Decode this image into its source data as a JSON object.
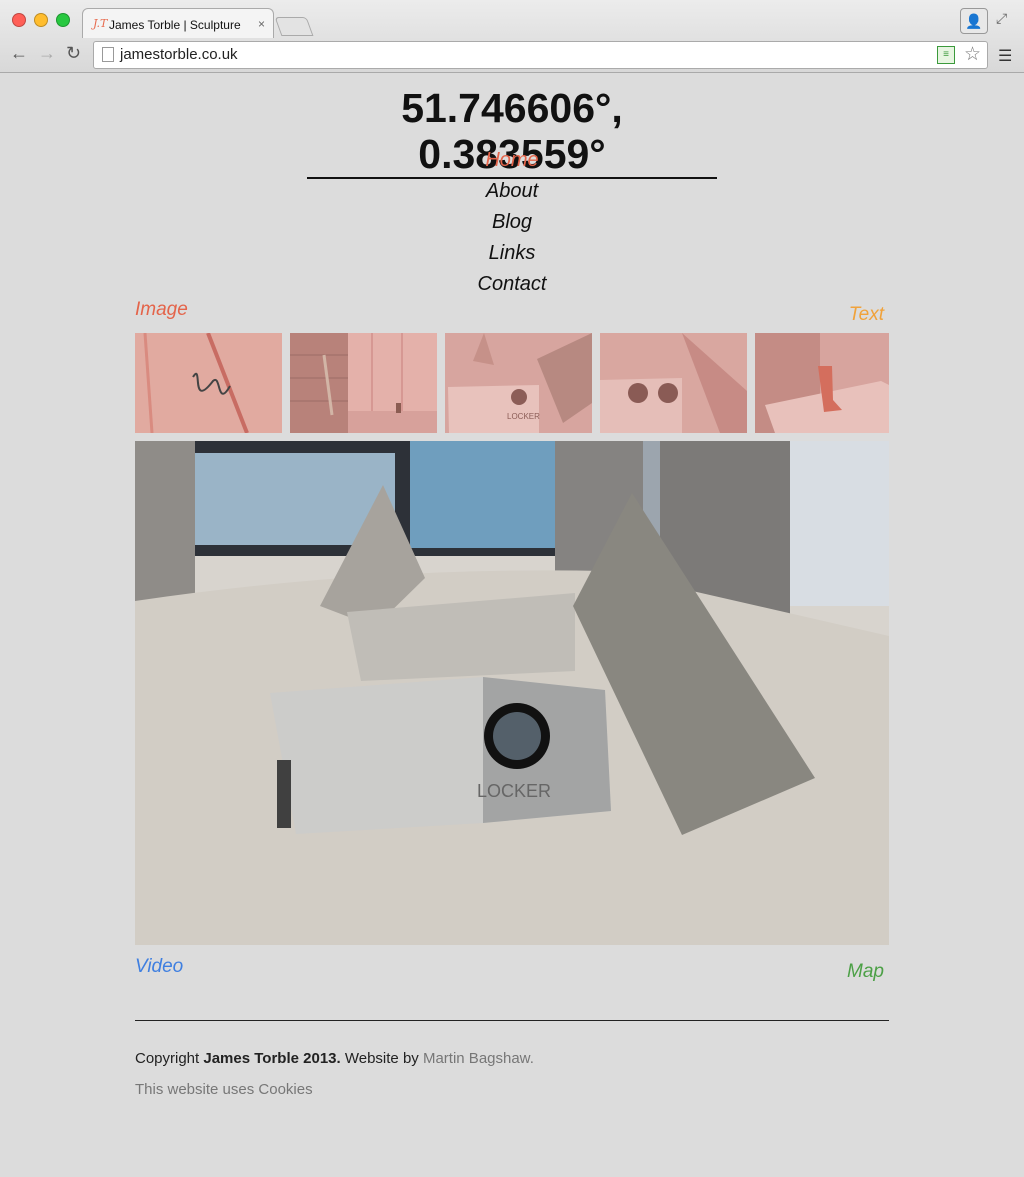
{
  "browser": {
    "tab": {
      "favicon": "J.T",
      "title": "James Torble | Sculpture",
      "close": "×"
    },
    "url": "jamestorble.co.uk",
    "colors": {
      "favicon": "#e76b4f"
    }
  },
  "site": {
    "title": "51.746606°, 0.383559°",
    "nav": [
      {
        "label": "Home",
        "active": true
      },
      {
        "label": "About",
        "active": false
      },
      {
        "label": "Blog",
        "active": false
      },
      {
        "label": "Links",
        "active": false
      },
      {
        "label": "Contact",
        "active": false
      }
    ],
    "corners": {
      "image": "Image",
      "text": "Text",
      "video": "Video",
      "map": "Map"
    },
    "colors": {
      "image": "#e4644a",
      "text": "#f0a23b",
      "video": "#3f7fe0",
      "map": "#4ca046"
    },
    "main_image_text": "LOCKER"
  },
  "footer": {
    "copyright_prefix": "Copyright",
    "owner": "James Torble 2013.",
    "website_by": "Website by",
    "designer": "Martin Bagshaw.",
    "cookies_prefix": "This website uses",
    "cookies_link": "Cookies"
  }
}
